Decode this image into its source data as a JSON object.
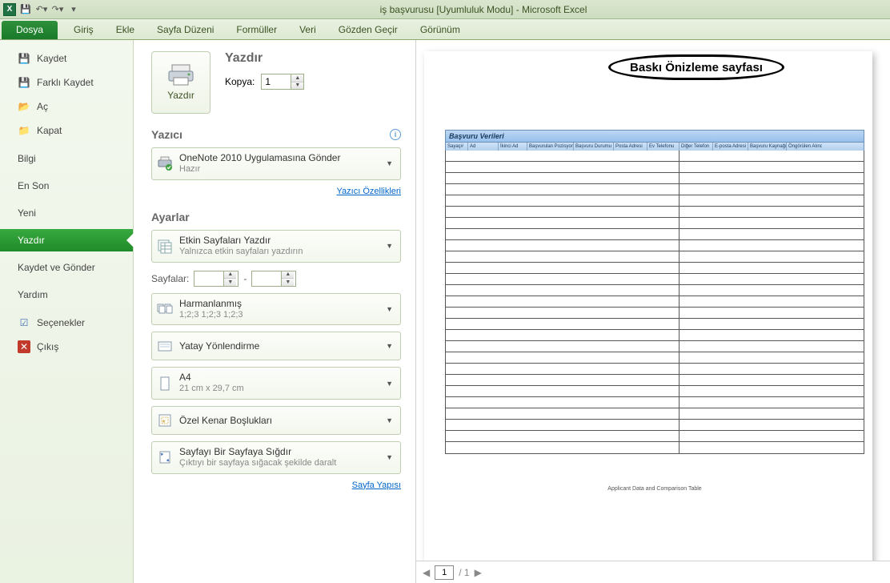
{
  "titlebar": {
    "title": "iş başvurusu  [Uyumluluk Modu]  -  Microsoft Excel"
  },
  "ribbon": {
    "file": "Dosya",
    "tabs": [
      "Giriş",
      "Ekle",
      "Sayfa Düzeni",
      "Formüller",
      "Veri",
      "Gözden Geçir",
      "Görünüm"
    ]
  },
  "sidebar": {
    "save": "Kaydet",
    "saveas": "Farklı Kaydet",
    "open": "Aç",
    "close": "Kapat",
    "info": "Bilgi",
    "recent": "En Son",
    "new": "Yeni",
    "print": "Yazdır",
    "sendshare": "Kaydet ve Gönder",
    "help": "Yardım",
    "options": "Seçenekler",
    "exit": "Çıkış"
  },
  "print": {
    "heading": "Yazdır",
    "button": "Yazdır",
    "copies_label": "Kopya:",
    "copies_value": "1",
    "printer_heading": "Yazıcı",
    "printer_name": "OneNote 2010 Uygulamasına Gönder",
    "printer_status": "Hazır",
    "printer_props": "Yazıcı Özellikleri",
    "settings_heading": "Ayarlar",
    "active_sheets_t": "Etkin Sayfaları Yazdır",
    "active_sheets_s": "Yalnızca etkin sayfaları yazdırın",
    "pages_label": "Sayfalar:",
    "pages_to": "-",
    "collated_t": "Harmanlanmış",
    "collated_s": "1;2;3    1;2;3    1;2;3",
    "orientation_t": "Yatay Yönlendirme",
    "paper_t": "A4",
    "paper_s": "21 cm x 29,7 cm",
    "margins_t": "Özel Kenar Boşlukları",
    "fit_t": "Sayfayı Bir Sayfaya Sığdır",
    "fit_s": "Çıktıyı bir sayfaya sığacak şekilde daralt",
    "page_setup": "Sayfa Yapısı"
  },
  "preview": {
    "annotation": "Baskı Önizleme sayfası",
    "table_title": "Başvuru Verileri",
    "columns": [
      "Sayaç#",
      "Ad",
      "İkinci Ad",
      "Başvurulan Pozisyon",
      "Başvuru Durumu",
      "Posta Adresi",
      "Ev Telefonu",
      "Diğer Telefon",
      "E-posta Adresi",
      "Başvuru Kaynağı",
      "Öngörülen Alındığı"
    ],
    "footnote": "Applicant Data and Comparison Table",
    "page_current": "1",
    "page_total": "/ 1"
  }
}
